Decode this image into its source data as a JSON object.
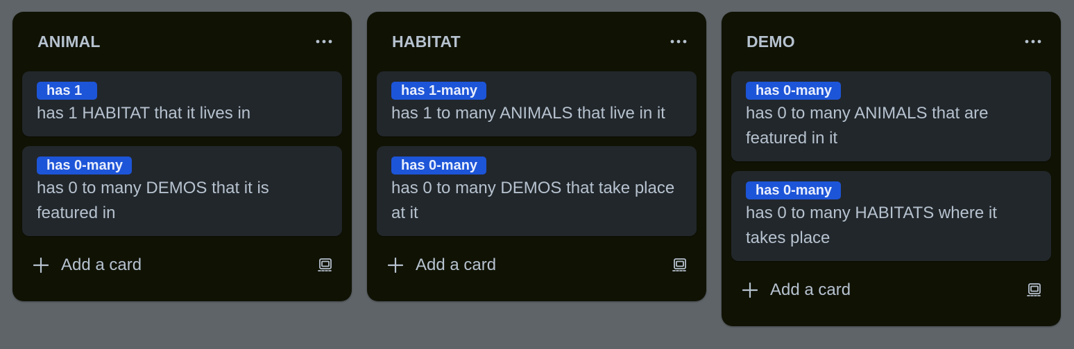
{
  "colors": {
    "background": "#5e6468",
    "list_background": "#101204",
    "card_background": "#22272b",
    "badge_background": "#1d55d8",
    "text": "#b6c2cf"
  },
  "lists": [
    {
      "title": "ANIMAL",
      "more_icon": "more-horizontal-icon",
      "cards": [
        {
          "badge": "has 1",
          "text": "has 1 HABITAT that it lives in"
        },
        {
          "badge": "has 0-many",
          "text": "has 0 to many DEMOS that it is featured in"
        }
      ],
      "add_label": "Add a card",
      "template_icon": "card-template-icon"
    },
    {
      "title": "HABITAT",
      "more_icon": "more-horizontal-icon",
      "cards": [
        {
          "badge": "has 1-many",
          "text": "has 1 to many ANIMALS that live in it"
        },
        {
          "badge": "has 0-many",
          "text": "has 0 to many DEMOS that take place at it"
        }
      ],
      "add_label": "Add a card",
      "template_icon": "card-template-icon"
    },
    {
      "title": "DEMO",
      "more_icon": "more-horizontal-icon",
      "cards": [
        {
          "badge": "has 0-many",
          "text": "has 0 to many ANIMALS that are featured in it"
        },
        {
          "badge": "has 0-many",
          "text": "has 0 to many HABITATS where it takes place"
        }
      ],
      "add_label": "Add a card",
      "template_icon": "card-template-icon"
    }
  ]
}
